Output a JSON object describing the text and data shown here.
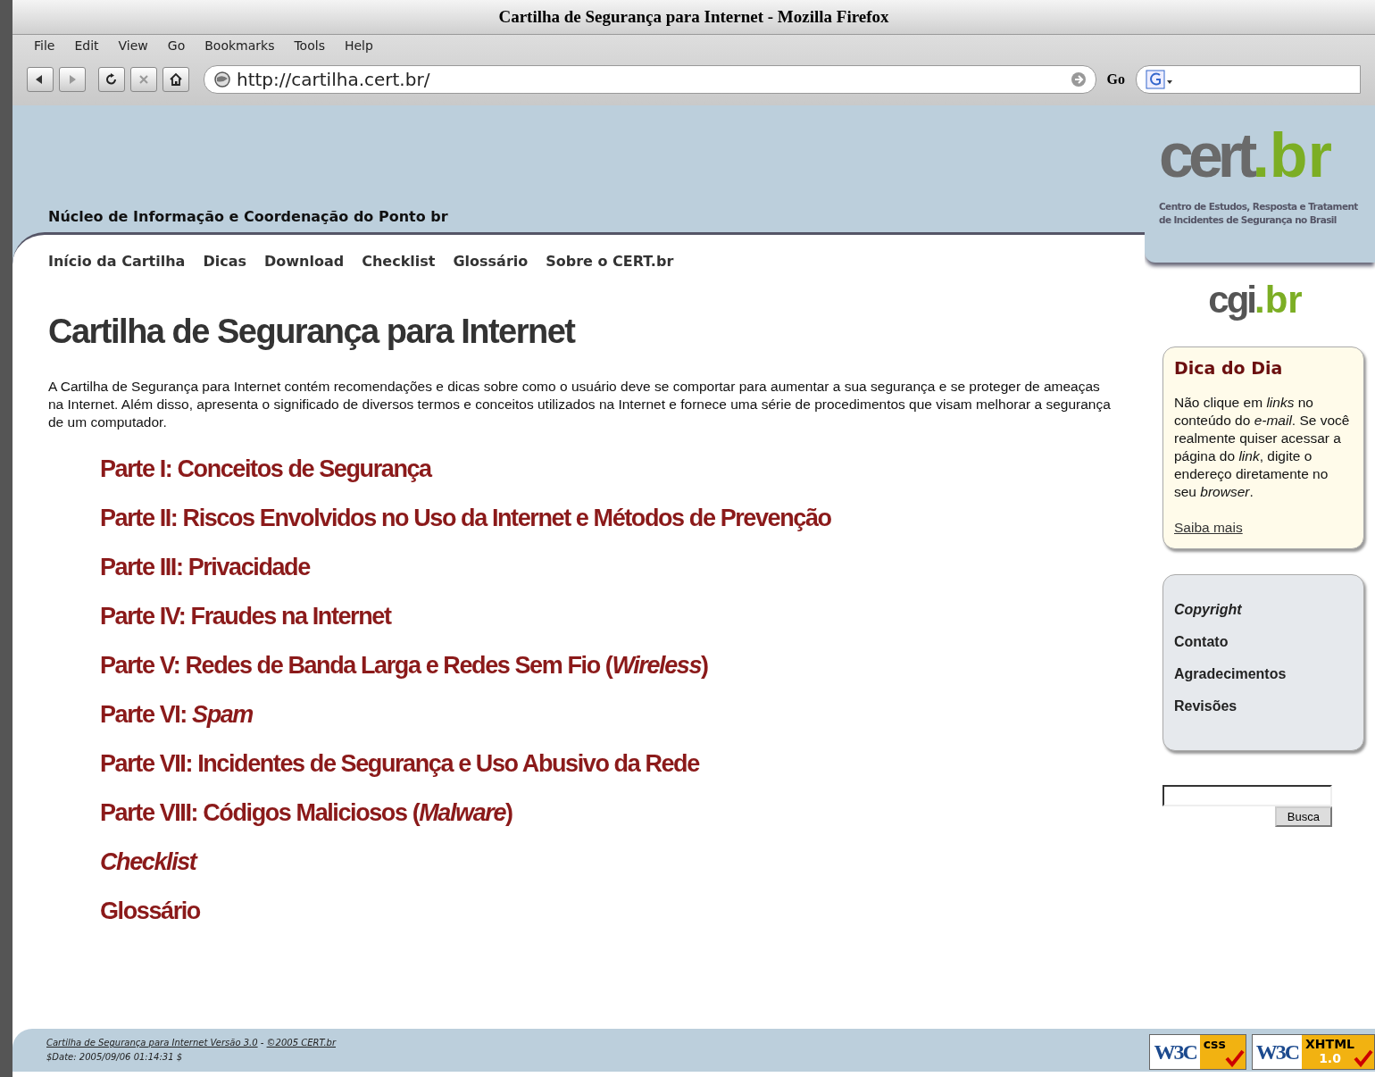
{
  "window": {
    "title": "Cartilha de Segurança para Internet - Mozilla Firefox"
  },
  "menu": [
    "File",
    "Edit",
    "View",
    "Go",
    "Bookmarks",
    "Tools",
    "Help"
  ],
  "toolbar": {
    "url": "http://cartilha.cert.br/",
    "go": "Go"
  },
  "header": {
    "org": "Núcleo de Informação e Coordenação do Ponto br",
    "logo": {
      "main": "cert",
      "suffix": ".br"
    },
    "logo_caption": [
      "Centro de Estudos, Resposta e Tratament",
      "de Incidentes de Segurança no Brasil"
    ],
    "sub_logo": {
      "main": "cgi",
      "suffix": ".br"
    }
  },
  "nav": [
    "Início da Cartilha",
    "Dicas",
    "Download",
    "Checklist",
    "Glossário",
    "Sobre o CERT.br"
  ],
  "title": "Cartilha de Segurança para Internet",
  "intro": "A Cartilha de Segurança para Internet contém recomendações e dicas sobre como o usuário deve se comportar para aumentar a sua segurança e se proteger de ameaças na Internet. Além disso, apresenta o significado de diversos termos e conceitos utilizados na Internet e fornece uma série de procedimentos que visam melhorar a segurança de um computador.",
  "parts": [
    {
      "text": "Parte I: Conceitos de Segurança",
      "italic": false
    },
    {
      "text": "Parte II: Riscos Envolvidos no Uso da Internet e Métodos de Prevenção",
      "italic": false
    },
    {
      "text": "Parte III: Privacidade",
      "italic": false
    },
    {
      "text": "Parte IV: Fraudes na Internet",
      "italic": false
    },
    {
      "text": "Parte V: Redes de Banda Larga e Redes Sem Fio (*Wireless*)",
      "italic": false
    },
    {
      "text": "Parte VI: *Spam*",
      "italic": false
    },
    {
      "text": "Parte VII: Incidentes de Segurança e Uso Abusivo da Rede",
      "italic": false
    },
    {
      "text": "Parte VIII: Códigos Maliciosos (*Malware*)",
      "italic": false
    },
    {
      "text": "Checklist",
      "italic": true
    },
    {
      "text": "Glossário",
      "italic": false
    }
  ],
  "tip": {
    "title": "Dica do Dia",
    "text": "Não clique em *links* no conteúdo do *e-mail*. Se você realmente quiser acessar a página do *link*, digite o endereço diretamente no seu *browser*.",
    "more": "Saiba mais"
  },
  "side_links": [
    {
      "text": "Copyright",
      "italic": true
    },
    {
      "text": "Contato",
      "italic": false
    },
    {
      "text": "Agradecimentos",
      "italic": false
    },
    {
      "text": "Revisões",
      "italic": false
    }
  ],
  "search": {
    "button": "Busca"
  },
  "footer": {
    "link1": "Cartilha de Segurança para Internet Versão 3.0",
    "sep": " - ",
    "link2": "©2005 CERT.br",
    "date": "$Date: 2005/09/06 01:14:31 $",
    "badges": [
      {
        "left": "W3C",
        "right": "css"
      },
      {
        "left": "W3C",
        "right": "XHTML",
        "version": "1.0"
      }
    ]
  }
}
